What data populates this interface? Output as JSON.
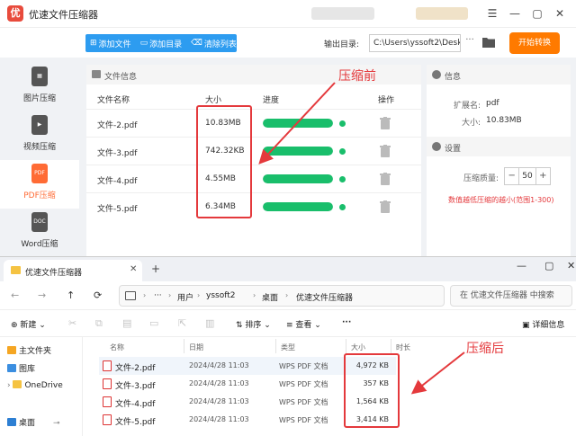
{
  "app": {
    "title": "优速文件压缩器",
    "logo_glyph": "优",
    "window_controls": [
      "☰",
      "—",
      "▢",
      "✕"
    ]
  },
  "toolbar": {
    "add_file": "添加文件",
    "add_dir": "添加目录",
    "clear_list": "清除列表",
    "output_label": "输出目录:",
    "output_path": "C:\\Users\\yssoft2\\Deskt",
    "output_more": "···",
    "start": "开始转换"
  },
  "sidebar": {
    "items": [
      {
        "label": "图片压缩",
        "icon": "image-file-icon",
        "glyph": "▦"
      },
      {
        "label": "视频压缩",
        "icon": "video-file-icon",
        "glyph": "▶"
      },
      {
        "label": "PDF压缩",
        "icon": "pdf-file-icon",
        "glyph": "PDF",
        "active": true
      },
      {
        "label": "Word压缩",
        "icon": "word-file-icon",
        "glyph": "DOC"
      }
    ]
  },
  "files": {
    "header": "文件信息",
    "columns": {
      "name": "文件名称",
      "size": "大小",
      "progress": "进度",
      "action": "操作"
    },
    "rows": [
      {
        "name": "文件-2.pdf",
        "size": "10.83MB",
        "progress": 1.0
      },
      {
        "name": "文件-3.pdf",
        "size": "742.32KB",
        "progress": 1.0
      },
      {
        "name": "文件-4.pdf",
        "size": "4.55MB",
        "progress": 1.0
      },
      {
        "name": "文件-5.pdf",
        "size": "6.34MB",
        "progress": 1.0
      }
    ]
  },
  "info": {
    "header": "信息",
    "ext_label": "扩展名:",
    "ext_value": "pdf",
    "size_label": "大小:",
    "size_value": "10.83MB"
  },
  "settings": {
    "header": "设置",
    "quality_label": "压缩质量:",
    "quality_value": "50",
    "minus": "−",
    "plus": "+",
    "hint": "数值越低压缩的越小(范围1-300)"
  },
  "annotations": {
    "before": "压缩前",
    "after": "压缩后",
    "color": "#e4393c"
  },
  "explorer": {
    "tab_title": "优速文件压缩器",
    "tab_close": "✕",
    "tab_add": "+",
    "window_controls": [
      "—",
      "▢",
      "✕"
    ],
    "nav": [
      "←",
      "→",
      "↑",
      "⟳"
    ],
    "crumbs": [
      "用户",
      "yssoft2",
      "桌面",
      "优速文件压缩器"
    ],
    "crumb_sep": "›",
    "ellipsis": "···",
    "search_placeholder": "在 优速文件压缩器 中搜索",
    "commands": {
      "new": "新建",
      "sort": "排序",
      "view": "查看",
      "more": "···",
      "details": "详细信息"
    },
    "nav_items": [
      "主文件夹",
      "图库",
      "OneDrive",
      "桌面"
    ],
    "columns": {
      "name": "名称",
      "date": "日期",
      "type": "类型",
      "size": "大小",
      "duration": "时长"
    },
    "rows": [
      {
        "name": "文件-2.pdf",
        "date": "2024/4/28 11:03",
        "type": "WPS PDF 文档",
        "size": "4,972 KB"
      },
      {
        "name": "文件-3.pdf",
        "date": "2024/4/28 11:03",
        "type": "WPS PDF 文档",
        "size": "357 KB"
      },
      {
        "name": "文件-4.pdf",
        "date": "2024/4/28 11:03",
        "type": "WPS PDF 文档",
        "size": "1,564 KB"
      },
      {
        "name": "文件-5.pdf",
        "date": "2024/4/28 11:03",
        "type": "WPS PDF 文档",
        "size": "3,414 KB"
      }
    ]
  }
}
